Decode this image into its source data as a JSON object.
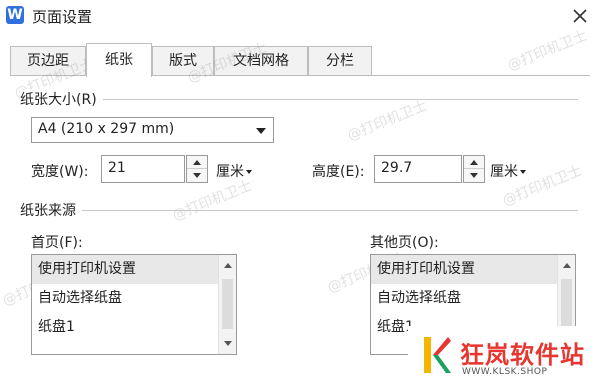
{
  "window": {
    "title": "页面设置",
    "app_icon_letter": "W"
  },
  "tabs": [
    {
      "label": "页边距",
      "active": false
    },
    {
      "label": "纸张",
      "active": true
    },
    {
      "label": "版式",
      "active": false
    },
    {
      "label": "文档网格",
      "active": false
    },
    {
      "label": "分栏",
      "active": false
    }
  ],
  "paper_size": {
    "group_title": "纸张大小(R)",
    "selected": "A4 (210 x 297 mm)",
    "width": {
      "label": "宽度(W):",
      "value": "21",
      "unit": "厘米"
    },
    "height": {
      "label": "高度(E):",
      "value": "29.7",
      "unit": "厘米"
    }
  },
  "paper_source": {
    "group_title": "纸张来源",
    "first_page": {
      "label": "首页(F):",
      "items": [
        "使用打印机设置",
        "自动选择纸盘",
        "纸盘1"
      ],
      "selected_index": 0
    },
    "other_pages": {
      "label": "其他页(O):",
      "items": [
        "使用打印机设置",
        "自动选择纸盘",
        "纸盘1"
      ],
      "selected_index": 0
    }
  },
  "watermark_text": "@打印机卫士",
  "brand": {
    "name": "狂岚软件站",
    "url": "WWW.KLSK.SHOP",
    "color": "#e8352f"
  },
  "colors": {
    "app_icon": "#2f6fe0"
  }
}
